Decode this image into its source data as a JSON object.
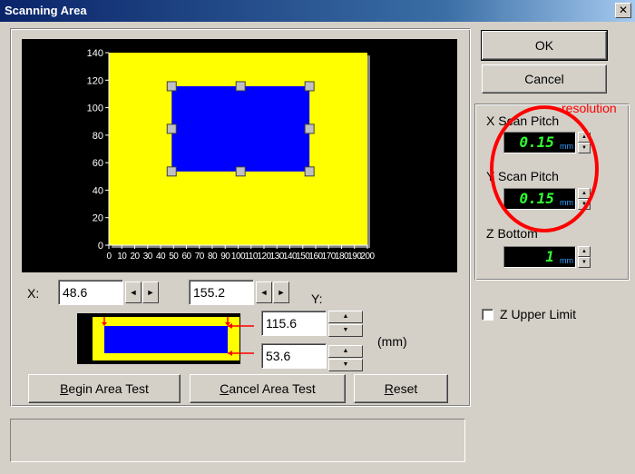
{
  "window": {
    "title": "Scanning Area",
    "close_glyph": "✕"
  },
  "chart_data": {
    "type": "scatter",
    "xlim": [
      0,
      200
    ],
    "ylim": [
      0,
      140
    ],
    "x_ticks": [
      "0",
      "10",
      "20",
      "30",
      "40",
      "50",
      "60",
      "70",
      "80",
      "90",
      "100",
      "110",
      "120",
      "130",
      "140",
      "150",
      "160",
      "170",
      "180",
      "190",
      "200"
    ],
    "y_ticks": [
      "0",
      "20",
      "40",
      "60",
      "80",
      "100",
      "120",
      "140"
    ],
    "scan_area": {
      "x_min": 48.6,
      "x_max": 155.2,
      "y_min": 53.6,
      "y_max": 115.6
    },
    "colors": {
      "background": "#000000",
      "plate": "#ffff00",
      "area": "#0000ff",
      "handle": "#c0c0c0"
    }
  },
  "coords": {
    "x_label": "X:",
    "y_label": "Y:",
    "x_min": "48.6",
    "x_max": "155.2",
    "y_max": "115.6",
    "y_min": "53.6",
    "unit": "(mm)",
    "left_arrow": "◄",
    "right_arrow": "►",
    "up_arrow": "▲",
    "down_arrow": "▼"
  },
  "buttons": {
    "begin_prefix": "B",
    "begin_rest": "egin Area Test",
    "cancel_area_prefix": "C",
    "cancel_area_rest": "ancel Area Test",
    "reset_prefix": "R",
    "reset_rest": "eset",
    "ok": "OK",
    "cancel": "Cancel"
  },
  "settings": {
    "annotation": "resolution",
    "x_pitch_label": "X Scan Pitch",
    "x_pitch_value": "0.15",
    "y_pitch_label": "Y Scan Pitch",
    "y_pitch_value": "0.15",
    "z_bottom_label": "Z Bottom",
    "z_bottom_value": "1",
    "unit": "mm",
    "z_upper_label": "Z Upper Limit",
    "z_upper_checked": false,
    "annotation_color": "#ff0000",
    "led_color": "#33ff33"
  }
}
